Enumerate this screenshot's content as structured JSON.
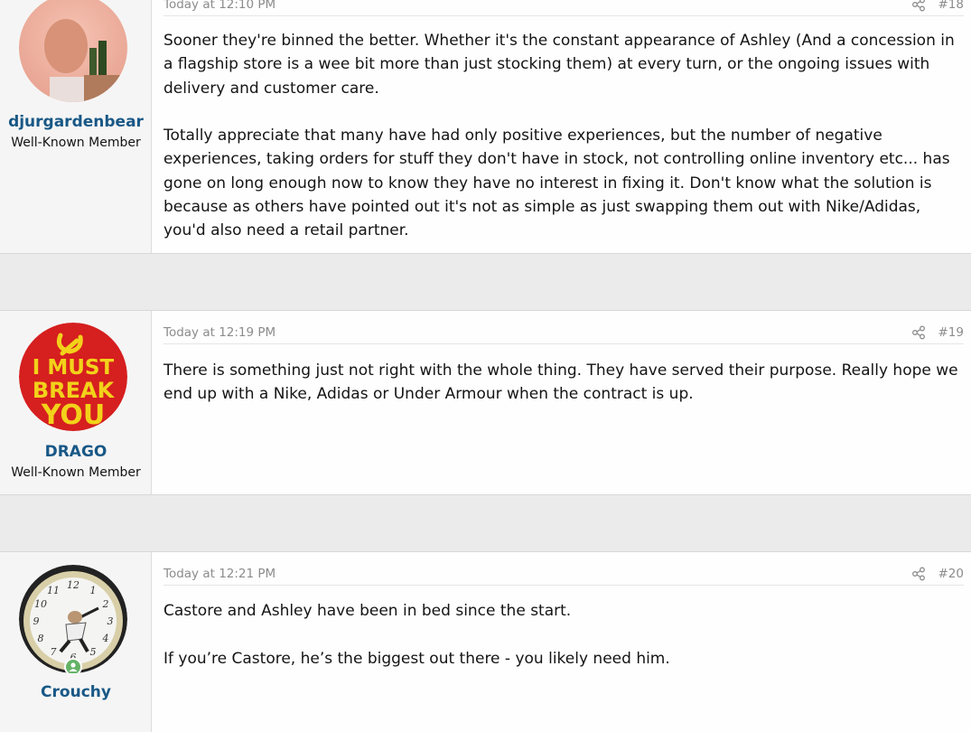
{
  "posts": [
    {
      "username": "djurgardenbear",
      "user_title": "Well-Known Member",
      "date": "Today at 12:10 PM",
      "post_number": "#18",
      "paragraphs": [
        "Sooner they're binned the better. Whether it's the constant appearance of Ashley (And a concession in a flagship store is a wee bit more than just stocking them) at every turn, or the ongoing issues with delivery and customer care.",
        "Totally appreciate that many have had only positive experiences, but the number of negative experiences, taking orders for stuff they don't have in stock, not controlling online inventory etc... has gone on long enough now to know they have no interest in fixing it. Don't know what the solution is because as others have pointed out it's not as simple as just swapping them out with Nike/Adidas, you'd also need a retail partner."
      ]
    },
    {
      "username": "DRAGO",
      "user_title": "Well-Known Member",
      "date": "Today at 12:19 PM",
      "post_number": "#19",
      "avatar_text": [
        "I MUST",
        "BREAK",
        "YOU"
      ],
      "paragraphs": [
        "There is something just not right with the whole thing. They have served their purpose. Really hope we end up with a Nike, Adidas or Under Armour when the contract is up."
      ]
    },
    {
      "username": "Crouchy",
      "user_title": "",
      "date": "Today at 12:21 PM",
      "post_number": "#20",
      "clock_numbers": [
        "12",
        "1",
        "2",
        "3",
        "4",
        "5",
        "6",
        "7",
        "8",
        "9",
        "10",
        "11"
      ],
      "paragraphs": [
        "Castore and Ashley have been in bed since the start.",
        "If you’re Castore, he’s the biggest out there - you likely need him."
      ]
    }
  ],
  "colors": {
    "username": "#185886",
    "meta": "#8c8c8c",
    "online": "#63b265"
  }
}
